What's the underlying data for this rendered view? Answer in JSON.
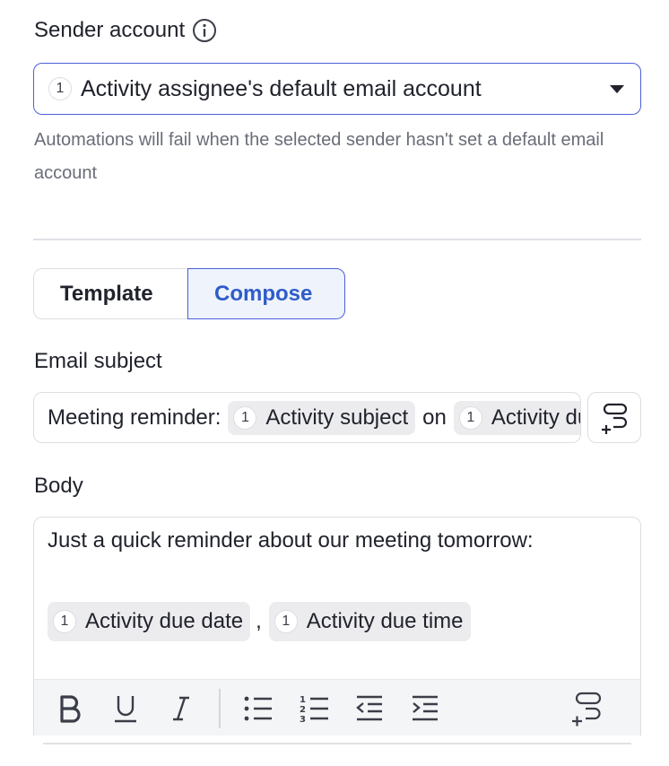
{
  "sender": {
    "label": "Sender account",
    "select_badge": "1",
    "select_value": "Activity assignee's default email account",
    "helper": "Automations will fail when the selected sender hasn't set a default email account"
  },
  "tabs": {
    "template": "Template",
    "compose": "Compose",
    "active": "Compose"
  },
  "subject": {
    "label": "Email subject",
    "prefix": "Meeting reminder:",
    "chip1_badge": "1",
    "chip1_text": "Activity subject",
    "middle": "on",
    "chip2_badge": "1",
    "chip2_text": "Activity due date"
  },
  "body": {
    "label": "Body",
    "line1": "Just a quick reminder about our meeting tomorrow:",
    "chip1_badge": "1",
    "chip1_text": "Activity due date",
    "separator": ",",
    "chip2_badge": "1",
    "chip2_text": "Activity due time"
  },
  "toolbar": {
    "icons": [
      "bold-icon",
      "underline-icon",
      "italic-icon",
      "bullet-list-icon",
      "numbered-list-icon",
      "outdent-icon",
      "indent-icon",
      "insert-field-icon"
    ]
  },
  "colors": {
    "accent": "#4b5fd9",
    "compose_text": "#2f5cc9",
    "compose_bg": "#eef3fc",
    "chip_bg": "#ececee",
    "helper_text": "#6a6d78"
  }
}
